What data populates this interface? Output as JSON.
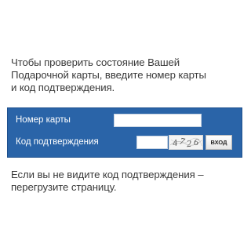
{
  "intro": {
    "line1": "Чтобы проверить состояние Вашей",
    "line2": "Подарочной карты, введите номер карты",
    "line3": "и код подтверждения."
  },
  "form": {
    "card_label": "Номер карты",
    "card_value": "",
    "code_label": "Код подтверждения",
    "code_value": "",
    "captcha_text": "4726",
    "submit_label": "вход",
    "panel_color": "#2a64a8"
  },
  "note": {
    "line1": "Если вы не видите код подтверждения –",
    "line2": "перегрузите страницу."
  }
}
